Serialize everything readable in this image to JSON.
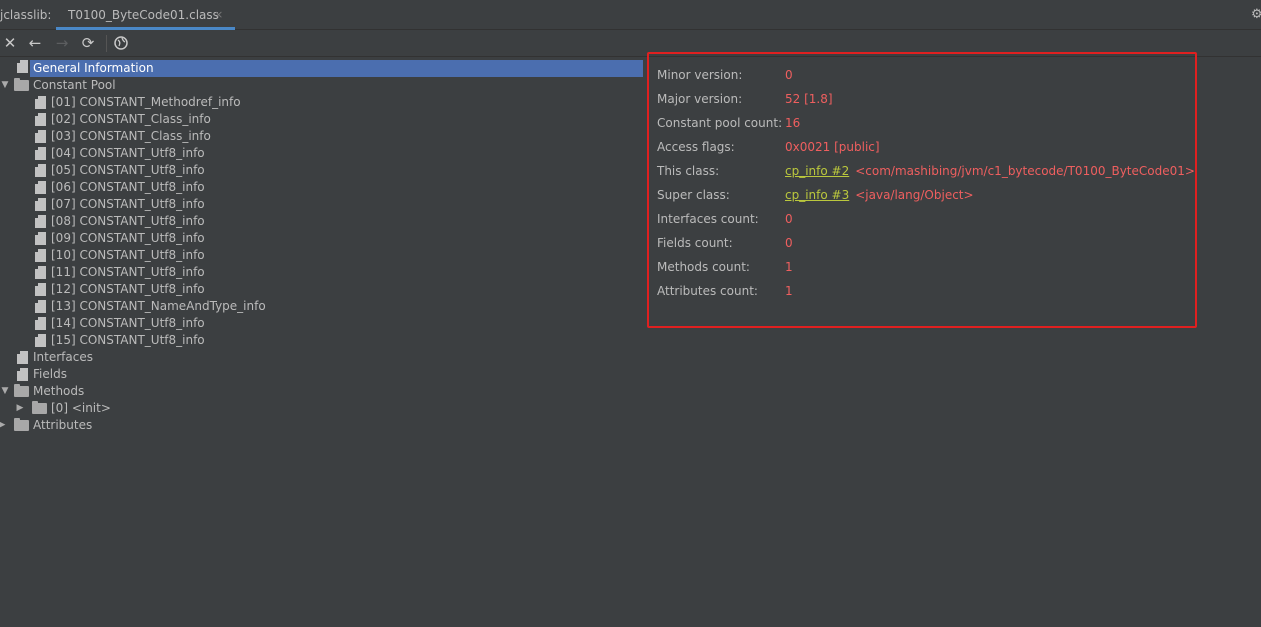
{
  "tabbar": {
    "tool_label": "jclasslib:",
    "tab_title": "T0100_ByteCode01.class",
    "close_glyph": "×",
    "settings_icon": "gear-icon"
  },
  "toolbar": {
    "close_glyph": "✕",
    "back_glyph": "←",
    "forward_glyph": "→",
    "refresh_glyph": "⟳",
    "web_glyph": "🌐"
  },
  "tree": {
    "general_information": "General Information",
    "constant_pool": "Constant Pool",
    "constants": [
      "[01] CONSTANT_Methodref_info",
      "[02] CONSTANT_Class_info",
      "[03] CONSTANT_Class_info",
      "[04] CONSTANT_Utf8_info",
      "[05] CONSTANT_Utf8_info",
      "[06] CONSTANT_Utf8_info",
      "[07] CONSTANT_Utf8_info",
      "[08] CONSTANT_Utf8_info",
      "[09] CONSTANT_Utf8_info",
      "[10] CONSTANT_Utf8_info",
      "[11] CONSTANT_Utf8_info",
      "[12] CONSTANT_Utf8_info",
      "[13] CONSTANT_NameAndType_info",
      "[14] CONSTANT_Utf8_info",
      "[15] CONSTANT_Utf8_info"
    ],
    "interfaces": "Interfaces",
    "fields": "Fields",
    "methods": "Methods",
    "method_init": "[0] <init>",
    "attributes": "Attributes"
  },
  "info": {
    "minor_version": {
      "label": "Minor version:",
      "value": "0"
    },
    "major_version": {
      "label": "Major version:",
      "value": "52 [1.8]"
    },
    "constant_pool_count": {
      "label": "Constant pool count:",
      "value": "16"
    },
    "access_flags": {
      "label": "Access flags:",
      "value": "0x0021 [public]"
    },
    "this_class": {
      "label": "This class:",
      "link": "cp_info #2",
      "value": "<com/mashibing/jvm/c1_bytecode/T0100_ByteCode01>"
    },
    "super_class": {
      "label": "Super class:",
      "link": "cp_info #3",
      "value": "<java/lang/Object>"
    },
    "interfaces_count": {
      "label": "Interfaces count:",
      "value": "0"
    },
    "fields_count": {
      "label": "Fields count:",
      "value": "0"
    },
    "methods_count": {
      "label": "Methods count:",
      "value": "1"
    },
    "attributes_count": {
      "label": "Attributes count:",
      "value": "1"
    }
  },
  "colors": {
    "background": "#3c3f41",
    "selection": "#4b6eaf",
    "value_red": "#ef5f5f",
    "link_yellow": "#bbc83d",
    "highlight_border": "#e02020"
  }
}
